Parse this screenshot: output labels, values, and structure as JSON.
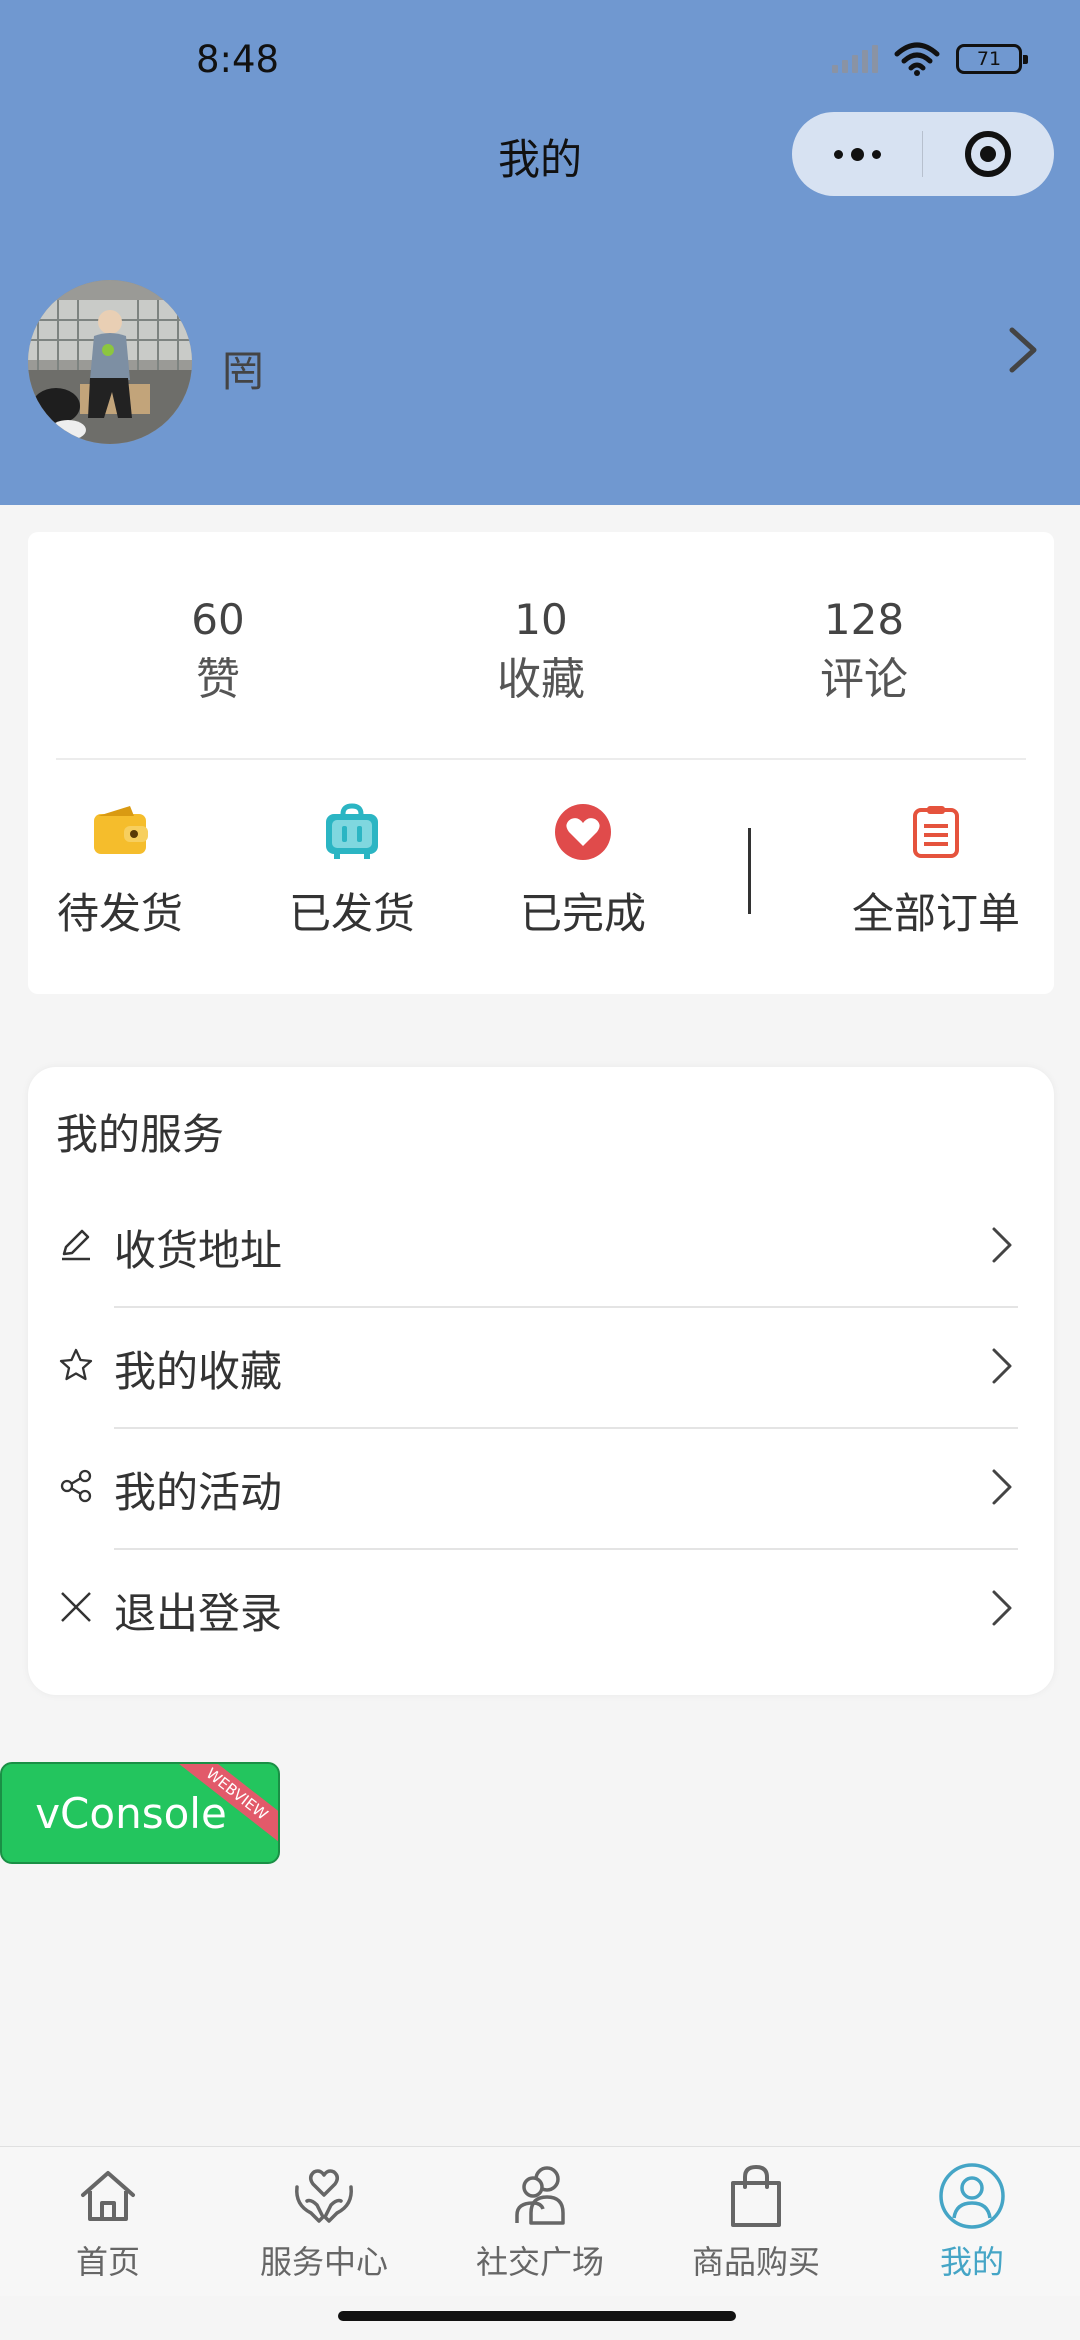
{
  "status_bar": {
    "time": "8:48",
    "battery": "71"
  },
  "nav": {
    "title": "我的"
  },
  "profile": {
    "name": "罔"
  },
  "stats": [
    {
      "value": "60",
      "label": "赞"
    },
    {
      "value": "10",
      "label": "收藏"
    },
    {
      "value": "128",
      "label": "评论"
    }
  ],
  "orders": [
    {
      "label": "待发货",
      "icon": "wallet-icon"
    },
    {
      "label": "已发货",
      "icon": "suitcase-icon"
    },
    {
      "label": "已完成",
      "icon": "heart-icon"
    },
    {
      "label": "全部订单",
      "icon": "clipboard-icon"
    }
  ],
  "services": {
    "title": "我的服务",
    "items": [
      {
        "label": "收货地址",
        "icon": "edit-icon"
      },
      {
        "label": "我的收藏",
        "icon": "star-icon"
      },
      {
        "label": "我的活动",
        "icon": "share-icon"
      },
      {
        "label": "退出登录",
        "icon": "close-icon"
      }
    ]
  },
  "vconsole": {
    "label": "vConsole",
    "ribbon": "WEBVIEW"
  },
  "tabbar": {
    "items": [
      {
        "label": "首页",
        "icon": "home-icon",
        "active": false
      },
      {
        "label": "服务中心",
        "icon": "hands-heart-icon",
        "active": false
      },
      {
        "label": "社交广场",
        "icon": "users-icon",
        "active": false
      },
      {
        "label": "商品购买",
        "icon": "shopping-bag-icon",
        "active": false
      },
      {
        "label": "我的",
        "icon": "user-icon",
        "active": true
      }
    ]
  },
  "colors": {
    "header_bg": "#7098d0",
    "wallet": "#f5bd2c",
    "suitcase": "#2bb5c3",
    "heart": "#e04b4b",
    "clipboard": "#e5533d",
    "tab_active": "#45a5c6",
    "vconsole": "#23c55e"
  }
}
